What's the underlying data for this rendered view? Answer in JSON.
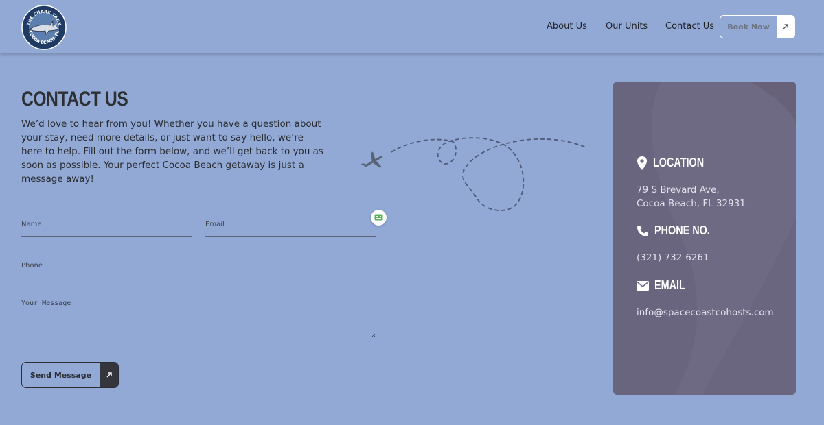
{
  "header": {
    "logo": {
      "top_text": "THE SHARK TANK",
      "bottom_text": "COCOA BEACH, FL"
    },
    "nav": [
      "About Us",
      "Our Units",
      "Contact Us"
    ],
    "book_label": "Book Now"
  },
  "contact": {
    "title": "CONTACT US",
    "intro": "We’d love to hear from you! Whether you have a question about your stay, need more details, or just want to say hello, we’re here to help. Fill out the form below, and we’ll get back to you as soon as possible. Your perfect Cocoa Beach getaway is just a message away!"
  },
  "form": {
    "name_placeholder": "Name",
    "email_placeholder": "Email",
    "phone_placeholder": "Phone",
    "message_placeholder": "Your Message",
    "send_label": "Send Message"
  },
  "info": {
    "location_heading": "LOCATION",
    "address_line1": "79 S Brevard Ave,",
    "address_line2": "Cocoa Beach, FL 32931",
    "phone_heading": "PHONE NO.",
    "phone": "(321) 732-6261",
    "email_heading": "EMAIL",
    "email": "info@spacecoastcohosts.com"
  },
  "icons": [
    "location-pin-icon",
    "phone-icon",
    "envelope-icon",
    "arrow-up-right-icon",
    "chat-icon",
    "airplane-icon"
  ],
  "colors": {
    "background": "#92a9d6",
    "card": "#6e6a83",
    "dark": "#35363b"
  }
}
